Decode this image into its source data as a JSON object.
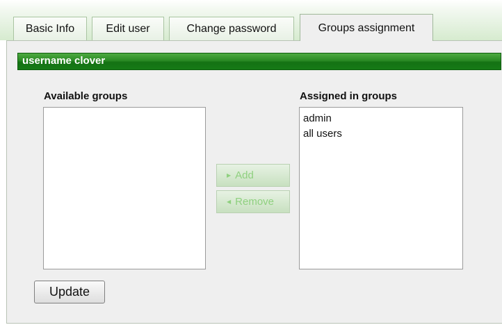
{
  "tabs": [
    {
      "label": "Basic Info"
    },
    {
      "label": "Edit user"
    },
    {
      "label": "Change password"
    },
    {
      "label": "Groups assignment"
    }
  ],
  "active_tab_index": 3,
  "header": {
    "title": "username clover"
  },
  "available": {
    "label": "Available groups",
    "items": []
  },
  "assigned": {
    "label": "Assigned in groups",
    "items": [
      "admin",
      "all users"
    ]
  },
  "actions": {
    "add_label": "Add",
    "remove_label": "Remove",
    "add_enabled": false,
    "remove_enabled": false
  },
  "update_label": "Update",
  "colors": {
    "header_green": "#2a8a24",
    "disabled_green_text": "#8fd07f",
    "panel_bg": "#efefef"
  }
}
